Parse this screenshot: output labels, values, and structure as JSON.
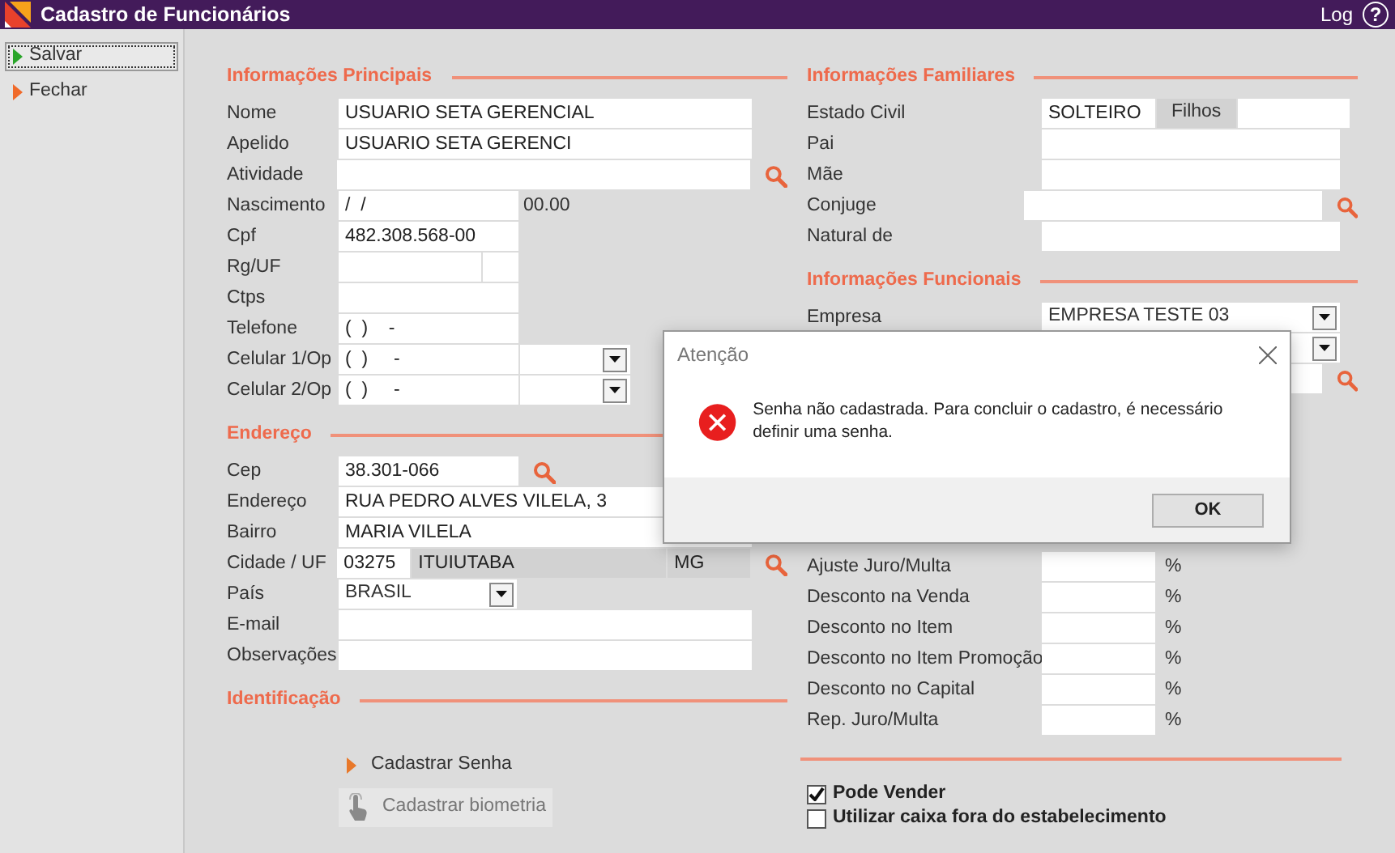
{
  "window": {
    "title": "Cadastro de Funcionários",
    "log_link": "Log",
    "help": "?"
  },
  "sidebar": [
    {
      "label": "Salvar",
      "kind": "save",
      "focused": true
    },
    {
      "label": "Fechar",
      "kind": "close",
      "focused": false
    }
  ],
  "left_sections": [
    {
      "title": "Informações Principais",
      "fields": [
        {
          "label": "Nome",
          "kind": "wide",
          "value": "USUARIO SETA GERENCIAL"
        },
        {
          "label": "Apelido",
          "kind": "wide",
          "value": "USUARIO SETA GERENCI"
        },
        {
          "label": "Atividade",
          "kind": "wide-search"
        },
        {
          "label": "Nascimento",
          "kind": "date",
          "value": "/  /",
          "note": "00.00"
        },
        {
          "label": "Cpf",
          "kind": "medium",
          "value": "482.308.568-00"
        },
        {
          "label": "Rg/UF",
          "kind": "pair"
        },
        {
          "label": "Ctps",
          "kind": "medium"
        },
        {
          "label": "Telefone",
          "kind": "medium",
          "value": "(  )    -"
        },
        {
          "label": "Celular 1/Op",
          "kind": "phone-op",
          "value": "(  )     -"
        },
        {
          "label": "Celular 2/Op",
          "kind": "phone-op",
          "value": "(  )     -"
        }
      ]
    },
    {
      "title": "Endereço",
      "fields": [
        {
          "label": "Cep",
          "kind": "medium-search",
          "value": "38.301-066"
        },
        {
          "label": "Endereço",
          "kind": "wide",
          "value": "RUA PEDRO ALVES VILELA, 3"
        },
        {
          "label": "Bairro",
          "kind": "wide",
          "value": "MARIA VILELA"
        },
        {
          "label": "Cidade / UF",
          "kind": "city",
          "value": "03275",
          "city": "ITUIUTABA",
          "uf": "MG"
        },
        {
          "label": "País",
          "kind": "short-select",
          "value": "BRASIL"
        },
        {
          "label": "E-mail",
          "kind": "wide"
        },
        {
          "label": "Observações",
          "kind": "wide"
        }
      ]
    },
    {
      "title": "Identificação",
      "actions": [
        {
          "label": "Cadastrar Senha",
          "kind": "arrow",
          "disabled": false
        },
        {
          "label": "Cadastrar biometria",
          "kind": "biometric",
          "disabled": true
        }
      ]
    }
  ],
  "right_sections": [
    {
      "title": "Informações Familiares",
      "fields": [
        {
          "label": "Estado Civil",
          "kind": "civil",
          "value": "SOLTEIRO",
          "inner_label": "Filhos"
        },
        {
          "label": "Pai",
          "kind": "wide"
        },
        {
          "label": "Mãe",
          "kind": "wide"
        },
        {
          "label": "Conjuge",
          "kind": "wide-search"
        },
        {
          "label": "Natural de",
          "kind": "wide"
        }
      ]
    },
    {
      "title": "Informações Funcionais",
      "fields": [
        {
          "label": "Empresa",
          "kind": "wide-select",
          "value": "EMPRESA TESTE 03"
        },
        {
          "kind": "wide-select"
        },
        {
          "kind": "wide-search"
        }
      ]
    },
    {
      "gap": true,
      "fields": [
        {
          "label": "Ajuste Juro/Multa",
          "kind": "percent",
          "unit": "%"
        },
        {
          "label": "Desconto na Venda",
          "kind": "percent",
          "unit": "%"
        },
        {
          "label": "Desconto no Item",
          "kind": "percent",
          "unit": "%"
        },
        {
          "label": "Desconto no Item Promoção",
          "kind": "percent",
          "unit": "%"
        },
        {
          "label": "Desconto no Capital",
          "kind": "percent",
          "unit": "%"
        },
        {
          "label": "Rep. Juro/Multa",
          "kind": "percent",
          "unit": "%"
        }
      ]
    },
    {
      "rule": true,
      "checkboxes": [
        {
          "label": "Pode Vender",
          "checked": true
        },
        {
          "label": "Utilizar caixa fora do estabelecimento",
          "checked": false
        }
      ]
    }
  ],
  "dialog": {
    "title": "Atenção",
    "message": "Senha não cadastrada. Para concluir o cadastro, é necessário definir uma senha.",
    "button": "OK"
  }
}
